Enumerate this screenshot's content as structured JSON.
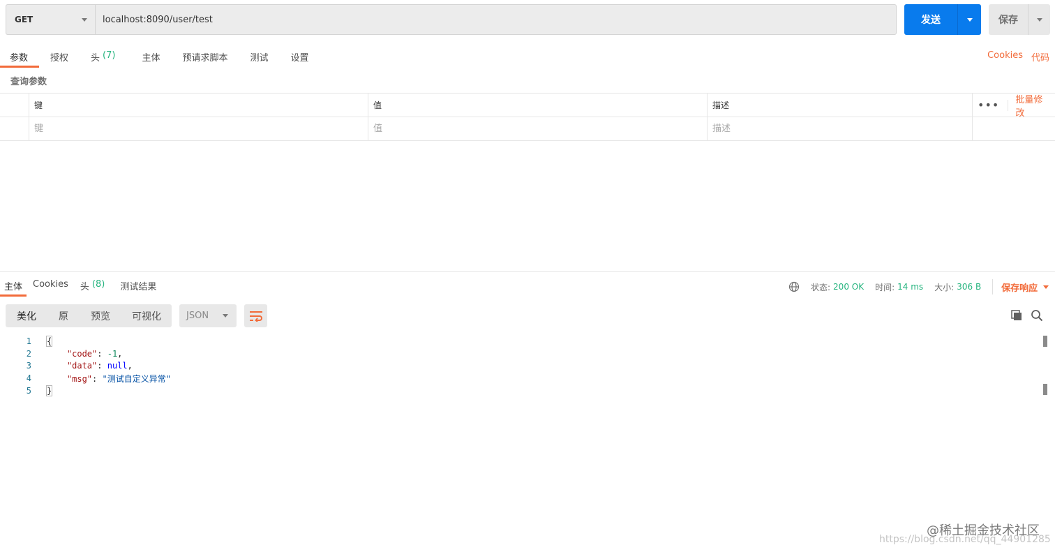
{
  "request": {
    "method": "GET",
    "url": "localhost:8090/user/test",
    "send_label": "发送",
    "save_label": "保存"
  },
  "req_tabs": [
    {
      "label": "参数",
      "count": ""
    },
    {
      "label": "授权",
      "count": ""
    },
    {
      "label": "头",
      "count": "(7)"
    },
    {
      "label": "主体",
      "count": ""
    },
    {
      "label": "预请求脚本",
      "count": ""
    },
    {
      "label": "测试",
      "count": ""
    },
    {
      "label": "设置",
      "count": ""
    }
  ],
  "req_links": {
    "cookies": "Cookies",
    "code": "代码"
  },
  "params": {
    "section_title": "查询参数",
    "headers": {
      "key": "键",
      "value": "值",
      "description": "描述"
    },
    "more": "•••",
    "bulk_edit": "批量修改",
    "placeholders": {
      "key": "键",
      "value": "值",
      "description": "描述"
    }
  },
  "resp_tabs": [
    {
      "label": "主体",
      "count": ""
    },
    {
      "label": "Cookies",
      "count": ""
    },
    {
      "label": "头",
      "count": "(8)"
    },
    {
      "label": "测试结果",
      "count": ""
    }
  ],
  "resp_status": {
    "status_label": "状态:",
    "status_value": "200 OK",
    "time_label": "时间:",
    "time_value": "14 ms",
    "size_label": "大小:",
    "size_value": "306 B",
    "save_response": "保存响应"
  },
  "resp_toolbar": {
    "views": [
      "美化",
      "原",
      "预览",
      "可视化"
    ],
    "format": "JSON"
  },
  "code": {
    "line_numbers": [
      "1",
      "2",
      "3",
      "4",
      "5"
    ],
    "open_brace": "{",
    "close_brace": "}",
    "k1": "\"code\"",
    "v1": "-1",
    "k2": "\"data\"",
    "v2": "null",
    "k3": "\"msg\"",
    "v3": "\"测试自定义异常\""
  },
  "watermark": {
    "line1": "@稀土掘金技术社区",
    "line2": "https://blog.csdn.net/qq_44901285"
  },
  "colors": {
    "accent": "#f26b3a",
    "send": "#097bed",
    "success": "#26b47f"
  }
}
